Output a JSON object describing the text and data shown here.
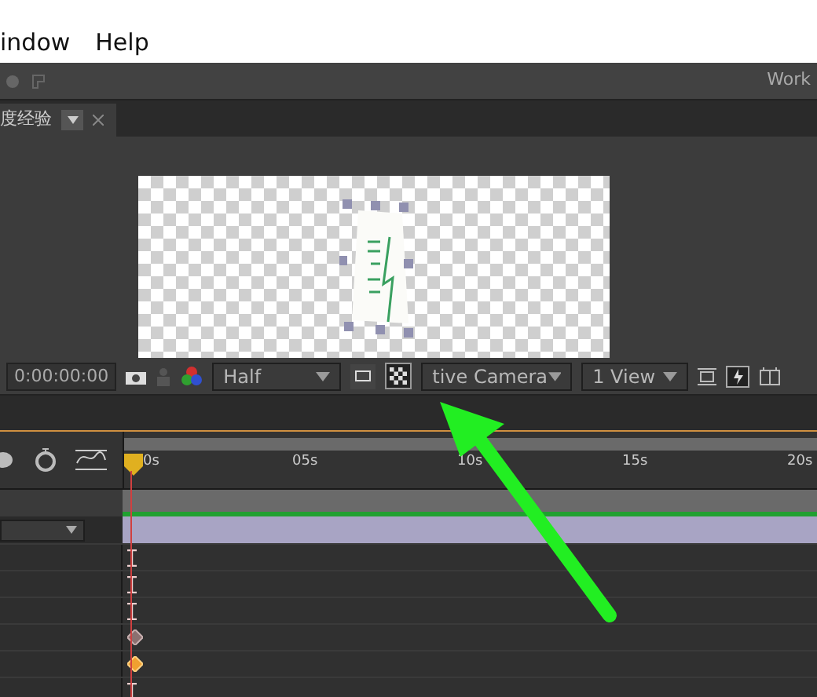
{
  "menu": [
    {
      "label": "indow"
    },
    {
      "label": "Help"
    }
  ],
  "workspace_label": "Work",
  "comp_tab": {
    "label": "度经验"
  },
  "viewer_toolbar": {
    "timecode": "0:00:00:00",
    "resolution": "Half",
    "transparency_grid": true,
    "camera": "tive Camera",
    "views": "1 View"
  },
  "timeline": {
    "ruler": [
      {
        "label": "0s"
      },
      {
        "label": "05s"
      },
      {
        "label": "10s"
      },
      {
        "label": "15s"
      },
      {
        "label": "20s"
      }
    ],
    "rows": [
      {
        "kind": "bracket"
      },
      {
        "kind": "bracket"
      },
      {
        "kind": "bracket"
      },
      {
        "kind": "diamond-inactive"
      },
      {
        "kind": "diamond-active"
      },
      {
        "kind": "bracket"
      }
    ]
  }
}
